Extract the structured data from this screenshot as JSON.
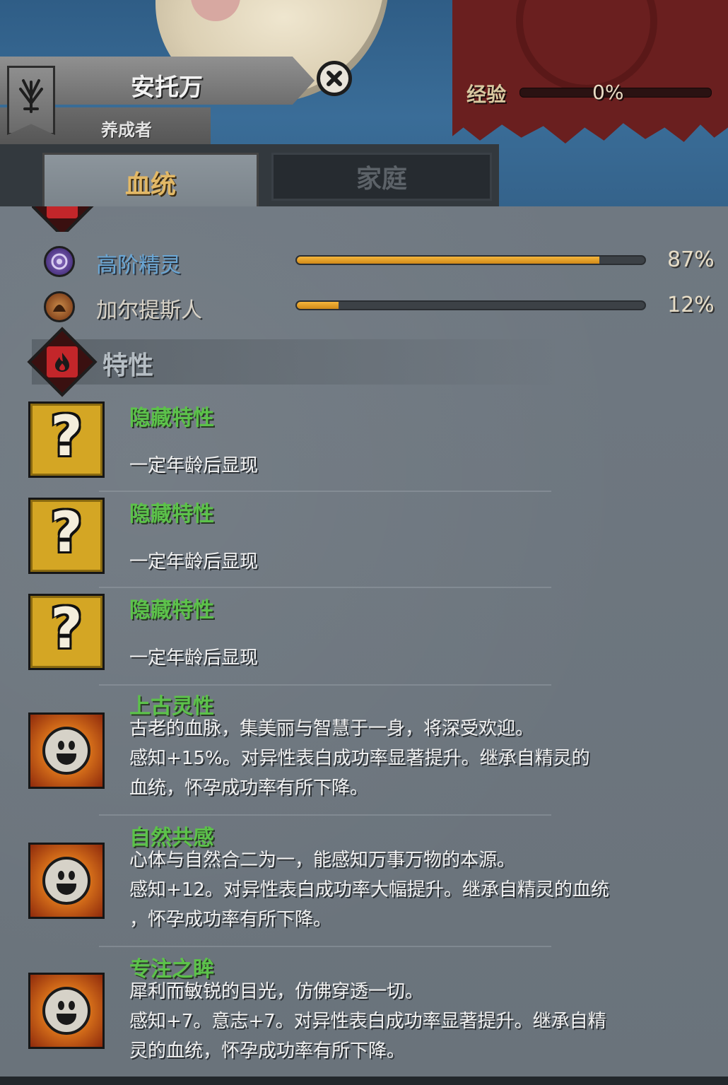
{
  "character": {
    "name": "安托万",
    "title": "养成者"
  },
  "experience": {
    "label": "经验",
    "value": "0%",
    "fraction": 0
  },
  "tabs": [
    {
      "label": "血统",
      "active": true
    },
    {
      "label": "家庭",
      "active": false
    }
  ],
  "bloodline": {
    "races": [
      {
        "name": "高阶精灵",
        "percent": "87%",
        "fraction": 0.87,
        "color": "#6aa6d4"
      },
      {
        "name": "加尔提斯人",
        "percent": "12%",
        "fraction": 0.12,
        "color": "#d8d2c6"
      }
    ]
  },
  "traits_section": {
    "title": "特性",
    "items": [
      {
        "name": "隐藏特性",
        "desc": "一定年龄后显现",
        "icon": "question-mark-icon"
      },
      {
        "name": "隐藏特性",
        "desc": "一定年龄后显现",
        "icon": "question-mark-icon"
      },
      {
        "name": "隐藏特性",
        "desc": "一定年龄后显现",
        "icon": "question-mark-icon"
      },
      {
        "name": "上古灵性",
        "desc": "古老的血脉，集美丽与智慧于一身，将深受欢迎。\n感知+15%。对异性表白成功率显著提升。继承自精灵的\n血统，怀孕成功率有所下降。",
        "icon": "smiley-sun-icon"
      },
      {
        "name": "自然共感",
        "desc": "心体与自然合二为一，能感知万事万物的本源。\n感知+12。对异性表白成功率大幅提升。继承自精灵的血统\n，怀孕成功率有所下降。",
        "icon": "smiley-sun-icon"
      },
      {
        "name": "专注之眸",
        "desc": "犀利而敏锐的目光，仿佛穿透一切。\n感知+7。意志+7。对异性表白成功率显著提升。继承自精\n灵的血统，怀孕成功率有所下降。",
        "icon": "smiley-sun-icon"
      }
    ]
  }
}
